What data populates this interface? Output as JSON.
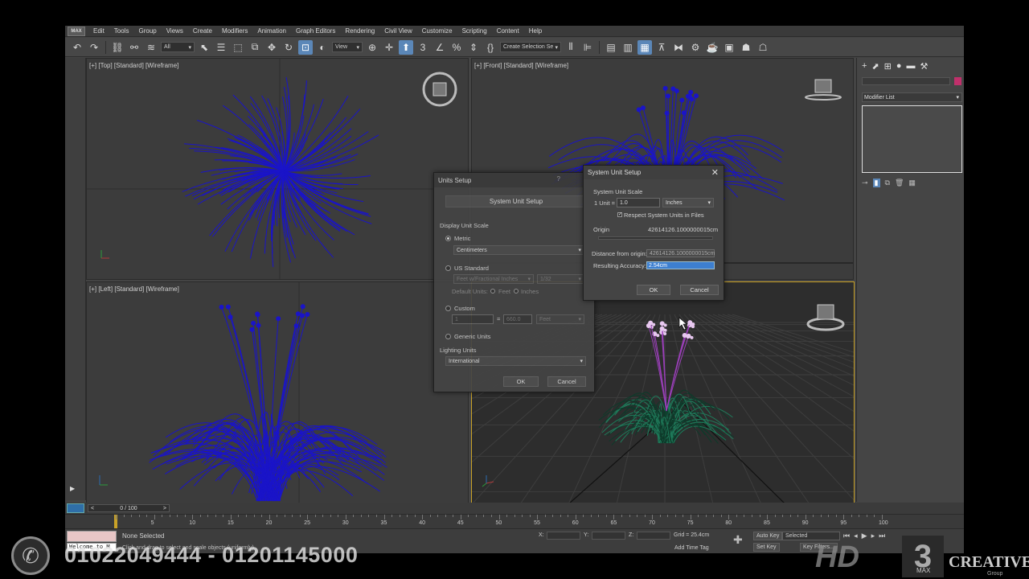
{
  "menu": {
    "logo": "MAX",
    "items": [
      "Edit",
      "Tools",
      "Group",
      "Views",
      "Create",
      "Modifiers",
      "Animation",
      "Graph Editors",
      "Rendering",
      "Civil View",
      "Customize",
      "Scripting",
      "Content",
      "Help"
    ]
  },
  "toolbar": {
    "filter_value": "All",
    "view_value": "View",
    "selection_set_placeholder": "Create Selection Se"
  },
  "viewports": {
    "top": "[+] [Top] [Standard] [Wireframe]",
    "front": "[+] [Front] [Standard] [Wireframe]",
    "left": "[+] [Left] [Standard] [Wireframe]"
  },
  "command_panel": {
    "modifier_list": "Modifier List"
  },
  "units_setup": {
    "title": "Units Setup",
    "help": "?",
    "system_unit_button": "System Unit Setup",
    "display_unit_scale": "Display Unit Scale",
    "metric": "Metric",
    "metric_value": "Centimeters",
    "us_standard": "US Standard",
    "us_value": "Feet w/Fractional Inches",
    "us_fraction": "1/32",
    "default_units": "Default Units:",
    "feet": "Feet",
    "inches": "Inches",
    "custom": "Custom",
    "custom_left": "1",
    "custom_eq": "=",
    "custom_right": "660.0",
    "custom_unit": "Feet",
    "generic_units": "Generic Units",
    "lighting_units": "Lighting Units",
    "lighting_value": "International",
    "ok": "OK",
    "cancel": "Cancel"
  },
  "system_unit_setup": {
    "title": "System Unit Setup",
    "close": "✕",
    "scale_label": "System Unit Scale",
    "unit_label": "1 Unit =",
    "unit_value": "1.0",
    "unit_type": "Inches",
    "respect_label": "Respect System Units in Files",
    "respect_checked": true,
    "origin_label": "Origin",
    "origin_value": "42614126.1000000015cm",
    "distance_label": "Distance from origin:",
    "distance_value": "42614126.1000000015cm",
    "accuracy_label": "Resulting Accuracy:",
    "accuracy_value": "2.54cm",
    "ok": "OK",
    "cancel": "Cancel"
  },
  "timeline": {
    "frame": "0 / 100",
    "ticks": [
      "5",
      "10",
      "15",
      "20",
      "25",
      "30",
      "35",
      "40",
      "45",
      "50",
      "55",
      "60",
      "65",
      "70",
      "75",
      "80",
      "85",
      "90",
      "95",
      "100"
    ]
  },
  "status": {
    "maxscript_text": "Welcome to M",
    "selection": "None Selected",
    "prompt": "Click and drag to select and scale objects (uniformly)",
    "x_label": "X:",
    "y_label": "Y:",
    "z_label": "Z:",
    "grid": "Grid = 25.4cm",
    "add_time_tag": "Add Time Tag",
    "auto_key": "Auto Key",
    "selected": "Selected",
    "set_key": "Set Key",
    "key_filters": "Key Filters..."
  },
  "overlay": {
    "phone": "01022049444 - 01201145000",
    "brand_hd": "HD",
    "brand_3": "3",
    "brand_max": "MAX",
    "brand_creative": "CREATIVE",
    "brand_group": "Group"
  },
  "colors": {
    "wire_blue": "#1a14c8",
    "selection_gold": "#c9a227",
    "highlight_blue": "#3d7fd0",
    "grass_green": "#1f7a5a",
    "flower_magenta": "#b04fc8"
  }
}
